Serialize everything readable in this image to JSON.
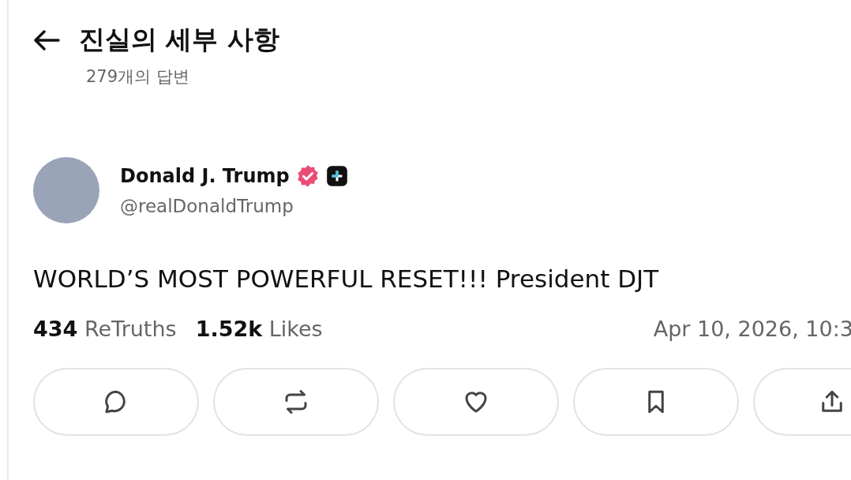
{
  "header": {
    "title": "진실의 세부 사항",
    "subtitle": "279개의 답변"
  },
  "author": {
    "name": "Donald J. Trump",
    "handle": "@realDonaldTrump",
    "verified": true
  },
  "post": {
    "text": "WORLD’S MOST POWERFUL RESET!!! President DJT"
  },
  "stats": [
    {
      "count": "434",
      "label": "ReTruths"
    },
    {
      "count": "1.52k",
      "label": "Likes"
    }
  ],
  "timestamp": "Apr 10, 2026, 10:3",
  "actions": [
    {
      "kind": "reply"
    },
    {
      "kind": "retruth"
    },
    {
      "kind": "like"
    },
    {
      "kind": "bookmark"
    },
    {
      "kind": "share"
    }
  ]
}
